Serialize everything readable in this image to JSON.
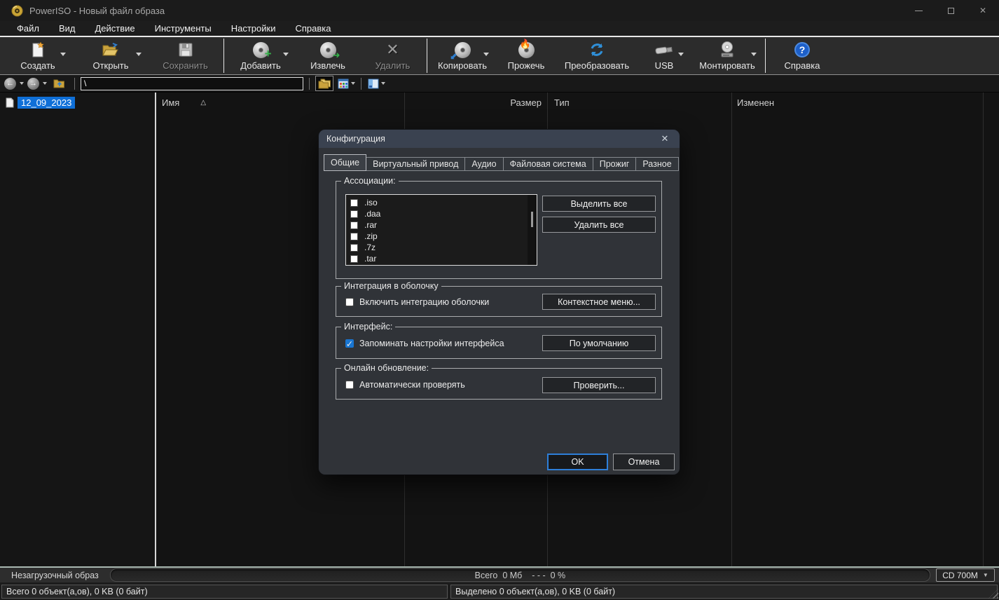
{
  "window": {
    "title": "PowerISO - Новый файл образа"
  },
  "glyphs": {
    "close": "✕",
    "back": "←",
    "forward": "→",
    "up": "↑",
    "help": "?",
    "delete": "✕",
    "check": "✓",
    "sort_asc": "△",
    "combo_arrow": "▼"
  },
  "colors": {
    "selection_blue": "#0f6fd7",
    "checkbox_checked": "#1976d2",
    "ok_border": "#2e7fd9",
    "dialog_titlebar": "#3a4250",
    "accent_folder": "#d9b44a",
    "disc_green": "#35b24a",
    "disc_blue": "#2f7fd0",
    "flame_red": "#d8402a",
    "help_blue": "#1d5fc8"
  },
  "menu": {
    "items": [
      "Файл",
      "Вид",
      "Действие",
      "Инструменты",
      "Настройки",
      "Справка"
    ]
  },
  "toolbar": {
    "buttons": [
      {
        "label": "Создать",
        "icon": "new-image-icon",
        "dropdown": true,
        "disabled": false
      },
      {
        "label": "Открыть",
        "icon": "open-folder-icon",
        "dropdown": true,
        "disabled": false
      },
      {
        "label": "Сохранить",
        "icon": "save-floppy-icon",
        "dropdown": false,
        "disabled": true
      },
      {
        "label": "Добавить",
        "icon": "add-disc-icon",
        "dropdown": true,
        "disabled": false
      },
      {
        "label": "Извлечь",
        "icon": "extract-disc-icon",
        "dropdown": false,
        "disabled": false
      },
      {
        "label": "Удалить",
        "icon": "delete-x-icon",
        "dropdown": false,
        "disabled": true
      },
      {
        "label": "Копировать",
        "icon": "copy-disc-icon",
        "dropdown": true,
        "disabled": false
      },
      {
        "label": "Прожечь",
        "icon": "burn-disc-icon",
        "dropdown": false,
        "disabled": false
      },
      {
        "label": "Преобразовать",
        "icon": "convert-arrows-icon",
        "dropdown": false,
        "disabled": false
      },
      {
        "label": "USB",
        "icon": "usb-drive-icon",
        "dropdown": true,
        "disabled": false
      },
      {
        "label": "Монтировать",
        "icon": "mount-disc-icon",
        "dropdown": true,
        "disabled": false
      },
      {
        "label": "Справка",
        "icon": "help-icon",
        "dropdown": false,
        "disabled": false
      }
    ]
  },
  "addressbar": {
    "path": "\\"
  },
  "sidebar": {
    "items": [
      {
        "label": "12_09_2023",
        "selected": true
      }
    ]
  },
  "file_list": {
    "columns": [
      "Имя",
      "Размер",
      "Тип",
      "Изменен"
    ]
  },
  "dialog": {
    "title": "Конфигурация",
    "tabs": [
      "Общие",
      "Виртуальный привод",
      "Аудио",
      "Файловая система",
      "Прожиг",
      "Разное"
    ],
    "active_tab": "Общие",
    "groups": {
      "associations": {
        "legend": "Ассоциации:",
        "items": [
          ".iso",
          ".daa",
          ".rar",
          ".zip",
          ".7z",
          ".tar"
        ],
        "items_checked": [
          false,
          false,
          false,
          false,
          false,
          false
        ],
        "select_all_label": "Выделить все",
        "remove_all_label": "Удалить все"
      },
      "shell": {
        "legend": "Интеграция в оболочку",
        "checkbox_label": "Включить интеграцию оболочки",
        "checked": false,
        "button_label": "Контекстное меню..."
      },
      "interface": {
        "legend": "Интерфейс:",
        "checkbox_label": "Запоминать настройки интерфейса",
        "checked": true,
        "button_label": "По умолчанию"
      },
      "update": {
        "legend": "Онлайн обновление:",
        "checkbox_label": "Автоматически проверять",
        "checked": false,
        "button_label": "Проверить..."
      }
    },
    "ok_label": "OK",
    "cancel_label": "Отмена"
  },
  "statusbar": {
    "boot_status": "Незагрузочный образ",
    "capacity_text": "Всего  0 Мб    - - -  0 %",
    "media_selector": "CD 700M",
    "total_objects": "Всего 0 объект(а,ов), 0 KB (0 байт)",
    "selected_objects": "Выделено 0 объект(а,ов), 0 KB (0 байт)"
  }
}
